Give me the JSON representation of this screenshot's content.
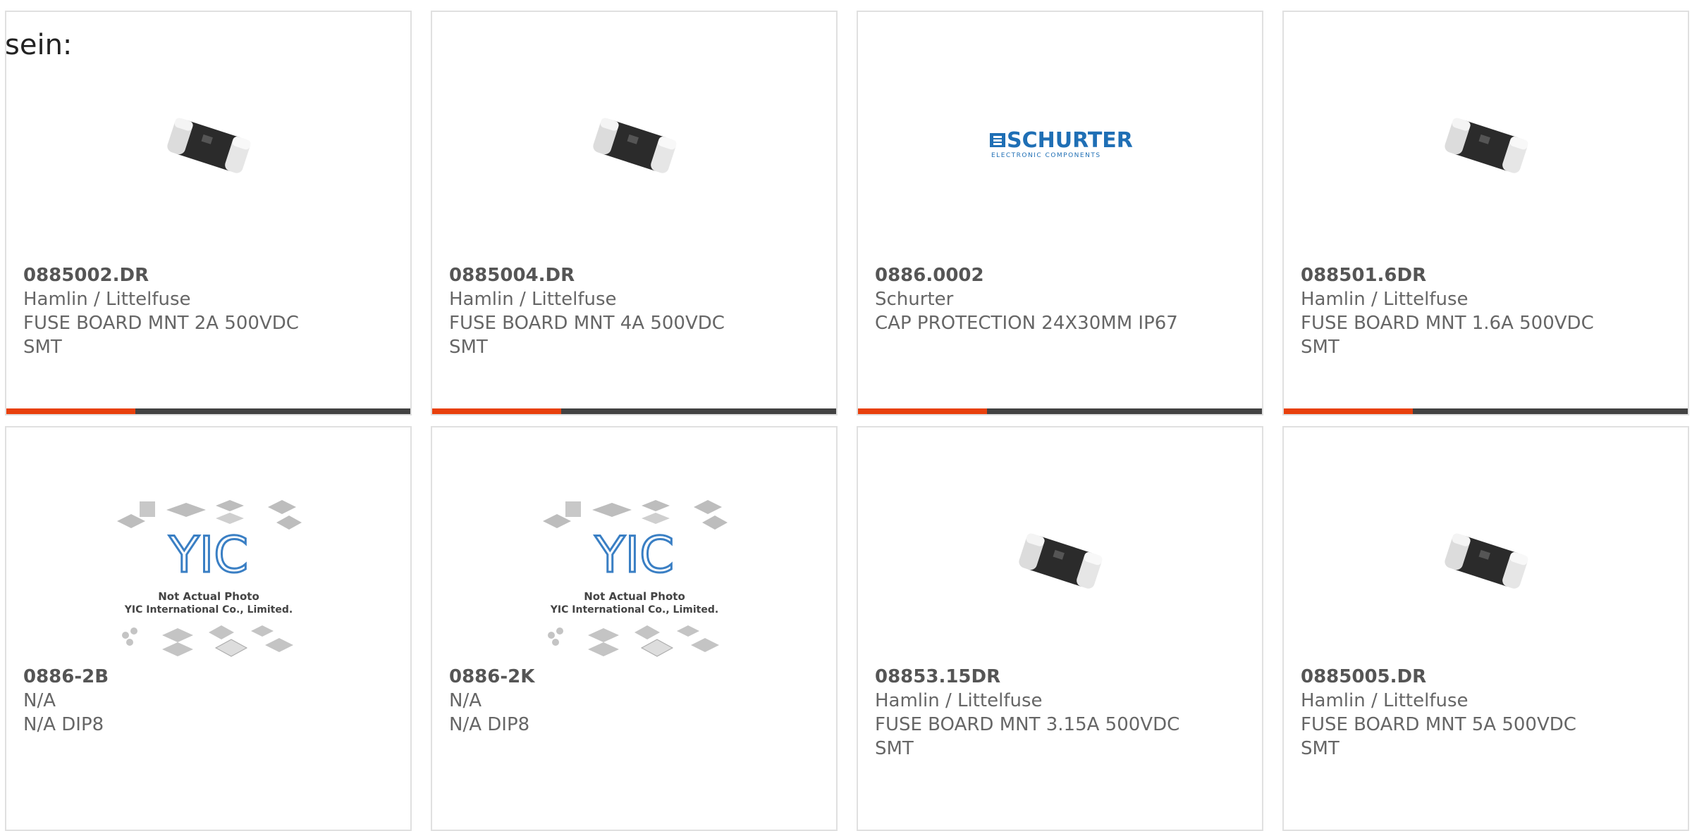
{
  "lead_text": "sein:",
  "colors": {
    "accent": "#e8400c",
    "bar": "#424242",
    "text": "#666666"
  },
  "products": [
    {
      "part": "0885002.DR",
      "manufacturer": "Hamlin / Littelfuse",
      "description": "FUSE BOARD MNT 2A 500VDC",
      "extra": "SMT",
      "image": "smd-fuse",
      "bar": true
    },
    {
      "part": "0885004.DR",
      "manufacturer": "Hamlin / Littelfuse",
      "description": "FUSE BOARD MNT 4A 500VDC",
      "extra": "SMT",
      "image": "smd-fuse",
      "bar": true
    },
    {
      "part": "0886.0002",
      "manufacturer": "Schurter",
      "description": "CAP PROTECTION 24X30MM IP67",
      "extra": "",
      "image": "schurter-logo",
      "bar": true
    },
    {
      "part": "088501.6DR",
      "manufacturer": "Hamlin / Littelfuse",
      "description": "FUSE BOARD MNT 1.6A 500VDC",
      "extra": "SMT",
      "image": "smd-fuse",
      "bar": true
    },
    {
      "part": "0886-2B",
      "manufacturer": "N/A",
      "description": "N/A DIP8",
      "extra": "",
      "image": "yic-placeholder",
      "bar": false
    },
    {
      "part": "0886-2K",
      "manufacturer": "N/A",
      "description": "N/A DIP8",
      "extra": "",
      "image": "yic-placeholder",
      "bar": false
    },
    {
      "part": "08853.15DR",
      "manufacturer": "Hamlin / Littelfuse",
      "description": "FUSE BOARD MNT 3.15A 500VDC",
      "extra": "SMT",
      "image": "smd-fuse",
      "bar": false
    },
    {
      "part": "0885005.DR",
      "manufacturer": "Hamlin / Littelfuse",
      "description": "FUSE BOARD MNT 5A 500VDC",
      "extra": "SMT",
      "image": "smd-fuse",
      "bar": false
    }
  ],
  "schurter_logo": {
    "name": "SCHURTER",
    "tagline": "ELECTRONIC COMPONENTS"
  },
  "yic_logo": {
    "name": "YIC",
    "line1": "Not Actual Photo",
    "line2": "YIC International Co., Limited."
  }
}
